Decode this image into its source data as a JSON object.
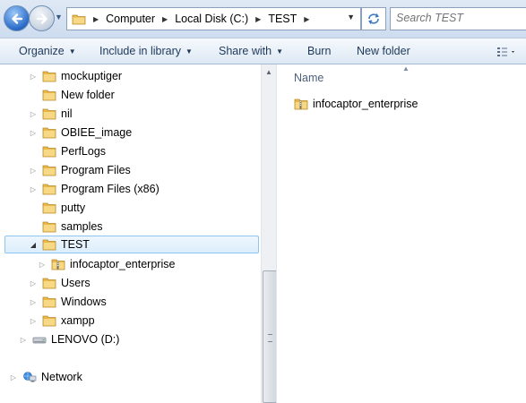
{
  "addressbar": {
    "back_icon": "back-arrow-icon",
    "forward_icon": "forward-arrow-icon",
    "breadcrumb": [
      "Computer",
      "Local Disk (C:)",
      "TEST"
    ],
    "search_placeholder": "Search TEST"
  },
  "toolbar": {
    "organize": "Organize",
    "include_in_library": "Include in library",
    "share_with": "Share with",
    "burn": "Burn",
    "new_folder": "New folder"
  },
  "navpane": {
    "items": [
      {
        "label": "mockuptiger",
        "expandable": true
      },
      {
        "label": "New folder",
        "expandable": false
      },
      {
        "label": "nil",
        "expandable": true
      },
      {
        "label": "OBIEE_image",
        "expandable": true
      },
      {
        "label": "PerfLogs",
        "expandable": false
      },
      {
        "label": "Program Files",
        "expandable": true
      },
      {
        "label": "Program Files (x86)",
        "expandable": true
      },
      {
        "label": "putty",
        "expandable": false
      },
      {
        "label": "samples",
        "expandable": false
      },
      {
        "label": "TEST",
        "expandable": true,
        "expanded": true,
        "selected": true
      },
      {
        "label": "infocaptor_enterprise",
        "expandable": true,
        "child": true,
        "zip": true
      },
      {
        "label": "Users",
        "expandable": true
      },
      {
        "label": "Windows",
        "expandable": true
      },
      {
        "label": "xampp",
        "expandable": true
      },
      {
        "label": "LENOVO (D:)",
        "expandable": true,
        "drive": true
      },
      {
        "label": "Network",
        "expandable": true,
        "network": true
      }
    ]
  },
  "content": {
    "column_name": "Name",
    "files": [
      {
        "label": "infocaptor_enterprise",
        "icon": "zip-folder-icon"
      }
    ]
  },
  "colors": {
    "accent": "#1e395b",
    "selection": "#dceefc",
    "folder": "#e8b84a"
  }
}
